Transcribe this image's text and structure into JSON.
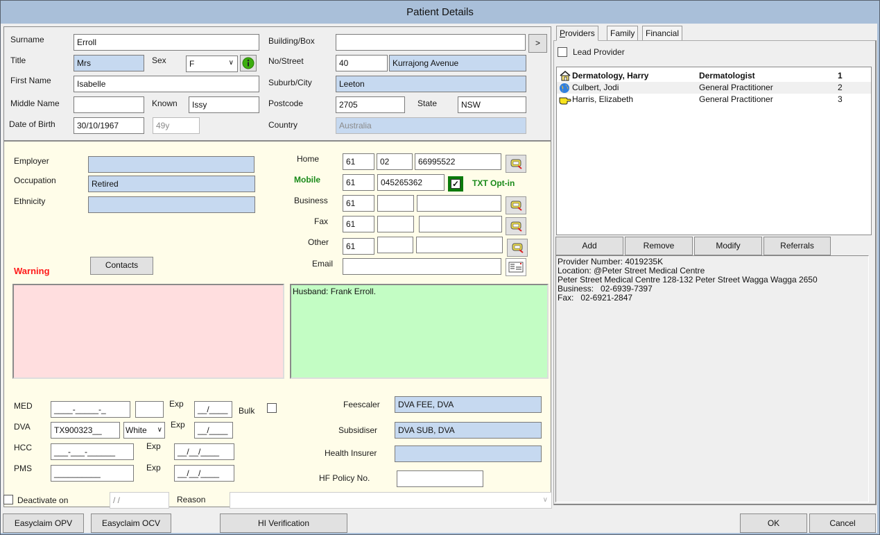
{
  "window": {
    "title": "Patient Details"
  },
  "demographics": {
    "surname_label": "Surname",
    "surname": "Erroll",
    "title_label": "Title",
    "title": "Mrs",
    "sex_label": "Sex",
    "sex": "F",
    "first_name_label": "First Name",
    "first_name": "Isabelle",
    "middle_name_label": "Middle Name",
    "middle_name": "",
    "known_label": "Known",
    "known": "Issy",
    "dob_label": "Date of Birth",
    "dob": "30/10/1967",
    "age": "49y"
  },
  "address": {
    "building_label": "Building/Box",
    "building": "",
    "expand_button": ">",
    "street_label": "No/Street",
    "street_no": "40",
    "street": "Kurrajong Avenue",
    "suburb_label": "Suburb/City",
    "suburb": "Leeton",
    "postcode_label": "Postcode",
    "postcode": "2705",
    "state_label": "State",
    "state": "NSW",
    "country_label": "Country",
    "country": "Australia"
  },
  "work": {
    "employer_label": "Employer",
    "employer": "",
    "occupation_label": "Occupation",
    "occupation": "Retired",
    "ethnicity_label": "Ethnicity",
    "ethnicity": ""
  },
  "contacts_button": "Contacts",
  "warning_label": "Warning",
  "warning_text": "",
  "notes_text": "Husband: Frank Erroll.",
  "phones": [
    {
      "label": "Home",
      "country": "61",
      "area": "02",
      "number": "66995522"
    },
    {
      "label": "Mobile",
      "country": "61",
      "area": "045265362",
      "number": ""
    },
    {
      "label": "Business",
      "country": "61",
      "area": "",
      "number": ""
    },
    {
      "label": "Fax",
      "country": "61",
      "area": "",
      "number": ""
    },
    {
      "label": "Other",
      "country": "61",
      "area": "",
      "number": ""
    }
  ],
  "txt_optin": {
    "label": "TXT Opt-in",
    "checked": true
  },
  "email": {
    "label": "Email",
    "value": ""
  },
  "cards": {
    "med_label": "MED",
    "med": "____-_____-_",
    "med_irn": "",
    "med_exp": "__/____",
    "bulk_label": "Bulk",
    "dva_label": "DVA",
    "dva": "TX900323__",
    "dva_card": "White",
    "dva_exp": "__/____",
    "hcc_label": "HCC",
    "hcc": "___-___-______",
    "hcc_exp": "__/__/____",
    "pms_label": "PMS",
    "pms": "__________",
    "pms_exp": "__/__/____",
    "exp_label": "Exp"
  },
  "billing": {
    "feescaler_label": "Feescaler",
    "feescaler": "DVA FEE, DVA",
    "subsidiser_label": "Subsidiser",
    "subsidiser": "DVA SUB, DVA",
    "insurer_label": "Health Insurer",
    "insurer": "",
    "policy_label": "HF Policy No.",
    "policy": ""
  },
  "deactivate": {
    "label": "Deactivate on",
    "date": " /  /",
    "reason_label": "Reason",
    "reason": ""
  },
  "footer": {
    "easyclaim_opv": "Easyclaim OPV",
    "easyclaim_ocv": "Easyclaim OCV",
    "hi_verification": "HI Verification",
    "ok": "OK",
    "cancel": "Cancel"
  },
  "providers_tab": {
    "tabs": [
      "Providers",
      "Family",
      "Financial"
    ],
    "lead_provider_label": "Lead Provider",
    "providers": [
      {
        "name": "Dermatology, Harry",
        "role": "Dermatologist",
        "rank": "1",
        "icon": "home-icon",
        "bold": true
      },
      {
        "name": "Culbert, Jodi",
        "role": "General Practitioner",
        "rank": "2",
        "icon": "globe-icon",
        "bold": false
      },
      {
        "name": "Harris, Elizabeth",
        "role": "General Practitioner",
        "rank": "3",
        "icon": "pointing-hand-icon",
        "bold": false
      }
    ],
    "buttons": [
      "Add",
      "Remove",
      "Modify",
      "Referrals"
    ],
    "details": [
      "Provider Number: 4019235K",
      "Location: @Peter Street Medical Centre",
      "Peter Street Medical Centre 128-132 Peter Street Wagga Wagga  2650",
      "Business:   02-6939-7397",
      "Fax:   02-6921-2847"
    ]
  }
}
